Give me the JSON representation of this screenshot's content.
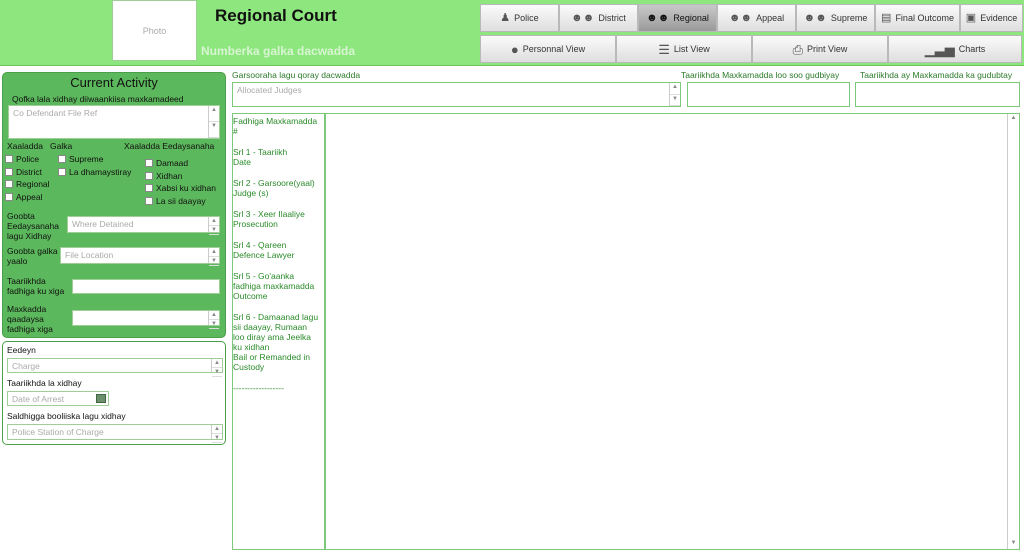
{
  "header": {
    "photo_label": "Photo",
    "title": "Regional Court",
    "case_number_label": "Numberka galka dacwadda"
  },
  "nav_tabs": [
    {
      "label": "Police",
      "icon": "police-officer-icon",
      "active": false
    },
    {
      "label": "District",
      "icon": "group-icon",
      "active": false
    },
    {
      "label": "Regional",
      "icon": "group-icon",
      "active": true
    },
    {
      "label": "Appeal",
      "icon": "group-icon",
      "active": false
    },
    {
      "label": "Supreme",
      "icon": "group-icon",
      "active": false
    },
    {
      "label": "Final Outcome",
      "icon": "newspaper-icon",
      "active": false
    },
    {
      "label": "Evidence",
      "icon": "box-icon",
      "active": false
    }
  ],
  "view_tabs": [
    {
      "label": "Personnal View",
      "icon": "person-icon"
    },
    {
      "label": "List View",
      "icon": "list-icon"
    },
    {
      "label": "Print View",
      "icon": "printer-icon"
    },
    {
      "label": "Charts",
      "icon": "bar-chart-icon"
    }
  ],
  "activity": {
    "title": "Current Activity",
    "co_defendant_label": "Qofka lala xidhay diiwaankiisa maxkamadeed",
    "co_defendant_placeholder": "Co Defendant File Ref",
    "xaaladda_label": "Xaaladda",
    "galka_label": "Galka",
    "xaaladda_eedaysanaha_label": "Xaaladda Eedaysanaha",
    "galka_options": [
      "Police",
      "District",
      "Regional",
      "Appeal"
    ],
    "supreme_options": [
      "Supreme",
      "La dhamaystiray"
    ],
    "status_options": [
      "Damaad",
      "Xidhan",
      "Xabsi ku xidhan",
      "La sii daayay"
    ],
    "detained_label": "Goobta Eedaysanaha lagu Xidhay",
    "detained_placeholder": "Where Detained",
    "file_location_label": "Goobta galka yaalo",
    "file_location_placeholder": "File Location",
    "file_date_label": "Taariikhda fadhiga ku xiga",
    "next_court_label": "Maxkadda qaadaysa fadhiga xiga"
  },
  "charges": {
    "charge_label": "Eedeyn",
    "charge_placeholder": "Charge",
    "arrest_label": "Taariikhda la xidhay",
    "arrest_placeholder": "Date of Arrest",
    "station_label": "Saldhigga booliiska lagu xidhay",
    "station_placeholder": "Police Station of Charge"
  },
  "main": {
    "judges_label": "Garsooraha lagu qoray dacwadda",
    "judges_placeholder": "Allocated Judges",
    "court_date_label": "Taariikhda Maxkamadda  loo soo gudbiyay",
    "court_date2_label": "Taariikhda ay Maxkamadda ka gudubtay",
    "srl_lines": [
      [
        "Fadhiga Maxkamadda",
        "#"
      ],
      [
        "Srl 1 - Taariikh",
        "Date"
      ],
      [
        "Srl 2 - Garsoore(yaal)",
        "Judge (s)"
      ],
      [
        "Srl 3 - Xeer Ilaaliye",
        "Prosecution"
      ],
      [
        "Srl 4 - Qareen",
        "Defence Lawyer"
      ],
      [
        "Srl 5 - Go'aanka",
        "fadhiga maxkamadda",
        "Outcome"
      ],
      [
        "Srl 6 - Damaanad lagu",
        "sii daayay, Rumaan",
        "loo diray ama Jeelka",
        "ku xidhan",
        "Bail or Remanded in",
        "Custody"
      ],
      [
        "   ------------------"
      ]
    ]
  },
  "colors": {
    "header_bg": "#8ee67e",
    "panel_green": "#5cb85c",
    "label_green": "#2a7a2a"
  }
}
